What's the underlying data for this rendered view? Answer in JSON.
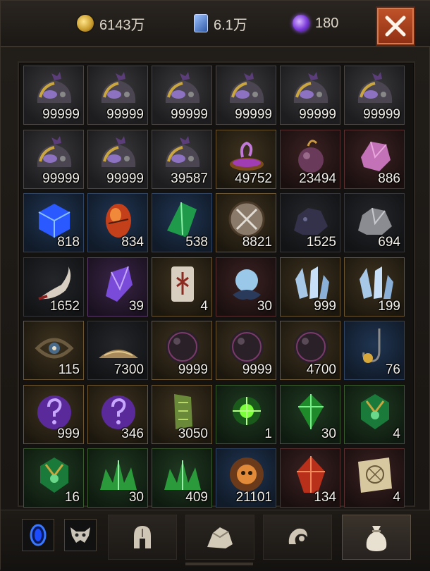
{
  "currency": {
    "gold": "6143万",
    "cards": "6.1万",
    "orbs": "180"
  },
  "close_icon": "close-icon",
  "items": [
    {
      "icon": "dark-helmet-icon",
      "qty": "99999",
      "rarity": "gray"
    },
    {
      "icon": "dark-helmet-icon",
      "qty": "99999",
      "rarity": "gray"
    },
    {
      "icon": "dark-helmet-icon",
      "qty": "99999",
      "rarity": "gray"
    },
    {
      "icon": "dark-helmet-icon",
      "qty": "99999",
      "rarity": "gray"
    },
    {
      "icon": "dark-helmet-icon",
      "qty": "99999",
      "rarity": "gray"
    },
    {
      "icon": "dark-helmet-icon",
      "qty": "99999",
      "rarity": "gray"
    },
    {
      "icon": "dark-helmet-icon",
      "qty": "99999",
      "rarity": "gray"
    },
    {
      "icon": "dark-helmet-icon",
      "qty": "99999",
      "rarity": "gray"
    },
    {
      "icon": "dark-helmet-icon",
      "qty": "39587",
      "rarity": "gray"
    },
    {
      "icon": "purple-cauldron-icon",
      "qty": "49752",
      "rarity": "gold"
    },
    {
      "icon": "purple-pouch-icon",
      "qty": "23494",
      "rarity": "red"
    },
    {
      "icon": "pink-crystal-icon",
      "qty": "886",
      "rarity": "red"
    },
    {
      "icon": "blue-cube-icon",
      "qty": "818",
      "rarity": "blue"
    },
    {
      "icon": "fire-egg-icon",
      "qty": "834",
      "rarity": "blue"
    },
    {
      "icon": "green-crystal-icon",
      "qty": "538",
      "rarity": "blue"
    },
    {
      "icon": "crossed-swords-medal-icon",
      "qty": "8821",
      "rarity": "gold"
    },
    {
      "icon": "dark-ore-icon",
      "qty": "1525",
      "rarity": "dark"
    },
    {
      "icon": "silver-ore-icon",
      "qty": "694",
      "rarity": "dark"
    },
    {
      "icon": "horn-fang-icon",
      "qty": "1652",
      "rarity": "dark"
    },
    {
      "icon": "purple-shard-icon",
      "qty": "39",
      "rarity": "purple"
    },
    {
      "icon": "rune-tablet-icon",
      "qty": "4",
      "rarity": "gold"
    },
    {
      "icon": "pearl-orb-icon",
      "qty": "30",
      "rarity": "red"
    },
    {
      "icon": "ice-crystal-icon",
      "qty": "999",
      "rarity": "gold"
    },
    {
      "icon": "ice-crystal-icon",
      "qty": "199",
      "rarity": "gold"
    },
    {
      "icon": "eye-amulet-icon",
      "qty": "115",
      "rarity": "gold"
    },
    {
      "icon": "sand-pile-icon",
      "qty": "7300",
      "rarity": "dark"
    },
    {
      "icon": "dark-sphere-icon",
      "qty": "9999",
      "rarity": "gold"
    },
    {
      "icon": "dark-sphere-icon",
      "qty": "9999",
      "rarity": "gold"
    },
    {
      "icon": "dark-sphere-icon",
      "qty": "4700",
      "rarity": "gold"
    },
    {
      "icon": "fishing-hook-icon",
      "qty": "76",
      "rarity": "blue"
    },
    {
      "icon": "mystery-purple-stone-icon",
      "qty": "999",
      "rarity": "gold"
    },
    {
      "icon": "mystery-purple-stone-icon",
      "qty": "346",
      "rarity": "gold"
    },
    {
      "icon": "green-relic-icon",
      "qty": "3050",
      "rarity": "gold"
    },
    {
      "icon": "green-orb-icon",
      "qty": "1",
      "rarity": "green"
    },
    {
      "icon": "green-gem-icon",
      "qty": "30",
      "rarity": "green"
    },
    {
      "icon": "green-emblem-icon",
      "qty": "4",
      "rarity": "green"
    },
    {
      "icon": "green-emblem-icon",
      "qty": "16",
      "rarity": "green"
    },
    {
      "icon": "green-shard-pile-icon",
      "qty": "30",
      "rarity": "green"
    },
    {
      "icon": "green-shard-pile-icon",
      "qty": "409",
      "rarity": "green"
    },
    {
      "icon": "fire-skull-orb-icon",
      "qty": "21101",
      "rarity": "blue"
    },
    {
      "icon": "red-crystal-icon",
      "qty": "134",
      "rarity": "red"
    },
    {
      "icon": "treasure-map-icon",
      "qty": "4",
      "rarity": "red"
    }
  ],
  "colors": {
    "gray": "#4a4643",
    "blue": "#2f4462",
    "gold": "#6b5631",
    "red": "#5a3030",
    "purple": "#5a3c68",
    "green": "#3a5a30",
    "dark": "#34363a"
  },
  "tabs": [
    {
      "icon": "helmet-tab-icon",
      "active": false
    },
    {
      "icon": "rock-tab-icon",
      "active": false
    },
    {
      "icon": "claw-tab-icon",
      "active": false
    },
    {
      "icon": "bag-tab-icon",
      "active": true
    }
  ],
  "mini_buttons": [
    {
      "icon": "blue-portal-icon"
    },
    {
      "icon": "demon-mask-icon"
    }
  ]
}
